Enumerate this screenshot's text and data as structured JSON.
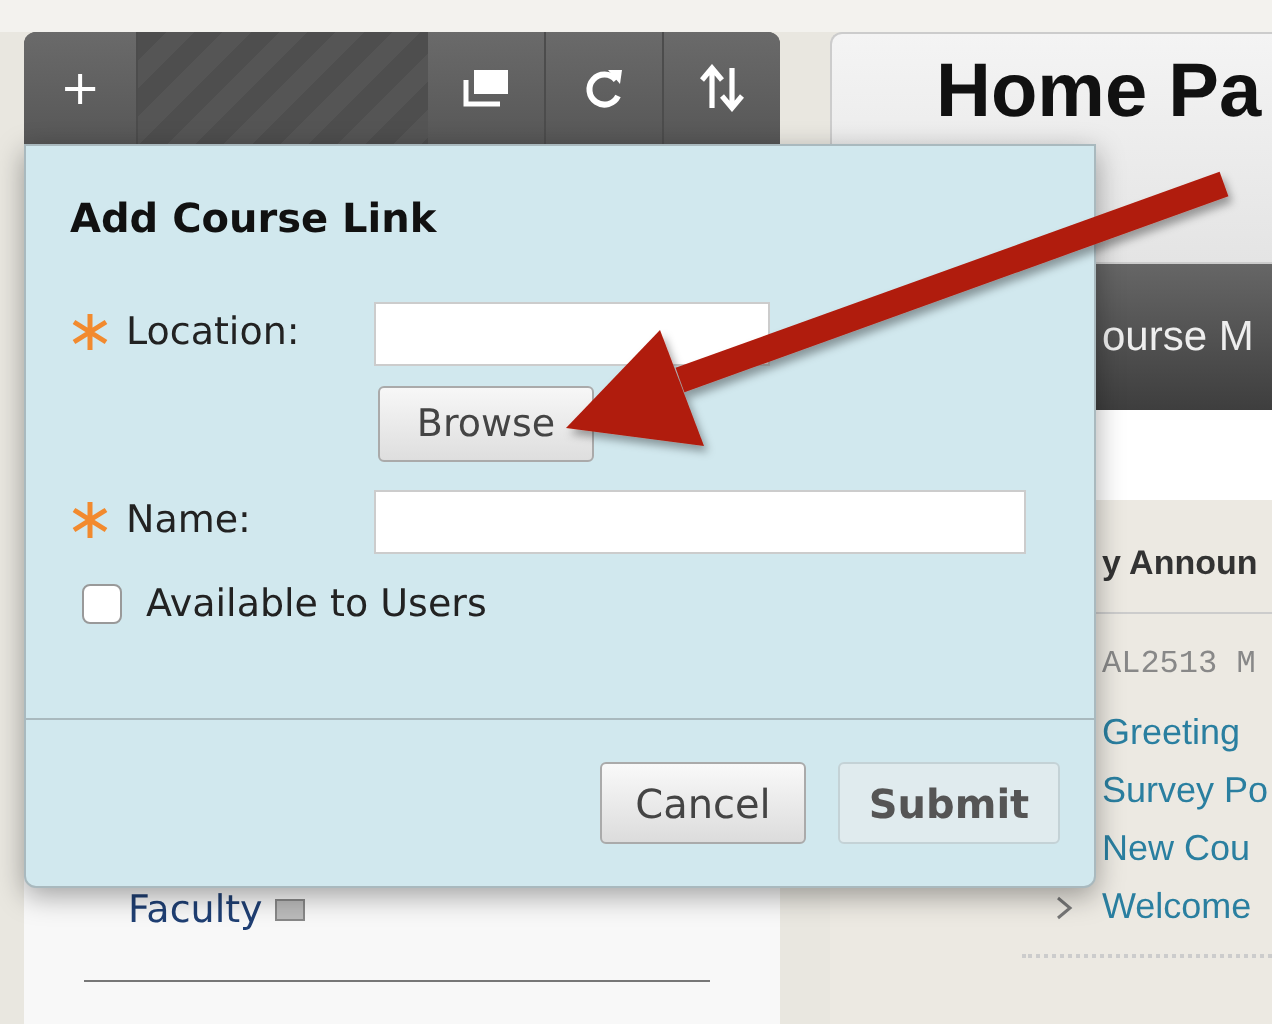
{
  "toolbar": {
    "buttons": [
      {
        "kind": "add",
        "label": "+"
      },
      {
        "kind": "spacer"
      },
      {
        "kind": "windows"
      },
      {
        "kind": "refresh"
      },
      {
        "kind": "sort"
      }
    ]
  },
  "sidebar": {
    "items": [
      {
        "label": "Faculty"
      }
    ]
  },
  "page": {
    "title": "Home Pa",
    "menu_bar": "ourse M",
    "module_title": "y Announ",
    "course_code": "AL2513 M",
    "links": [
      {
        "label": "Greeting",
        "kind": "plain"
      },
      {
        "label": "Survey Po",
        "kind": "plain"
      },
      {
        "label": "New Cou",
        "kind": "plain"
      },
      {
        "label": "Welcome",
        "kind": "bullet"
      }
    ]
  },
  "dialog": {
    "title": "Add Course Link",
    "fields": [
      {
        "kind": "text",
        "label": "Location:",
        "required": true,
        "has_browse": true,
        "browse_label": "Browse"
      },
      {
        "kind": "text",
        "label": "Name:",
        "required": true,
        "has_browse": false
      }
    ],
    "checkbox": {
      "label": "Available to Users",
      "checked": false
    },
    "buttons": [
      {
        "label": "Cancel",
        "kind": "secondary"
      },
      {
        "label": "Submit",
        "kind": "primary"
      }
    ]
  },
  "annotation": {
    "kind": "arrow"
  }
}
